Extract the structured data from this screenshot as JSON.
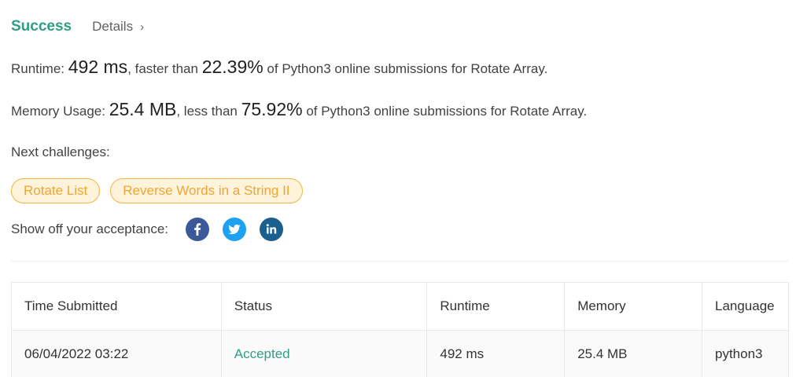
{
  "status": {
    "title": "Success",
    "details_label": "Details",
    "chevron": "›"
  },
  "runtime_line": {
    "label": "Runtime: ",
    "value": "492 ms",
    "middle": ", faster than ",
    "percent": "22.39%",
    "suffix": " of Python3 online submissions for Rotate Array."
  },
  "memory_line": {
    "label": "Memory Usage: ",
    "value": "25.4 MB",
    "middle": ", less than ",
    "percent": "75.92%",
    "suffix": " of Python3 online submissions for Rotate Array."
  },
  "next": {
    "label": "Next challenges:",
    "challenges": [
      "Rotate List",
      "Reverse Words in a String II"
    ]
  },
  "share": {
    "label": "Show off your acceptance:",
    "icons": [
      "facebook-icon",
      "twitter-icon",
      "linkedin-icon"
    ]
  },
  "table": {
    "headers": [
      "Time Submitted",
      "Status",
      "Runtime",
      "Memory",
      "Language"
    ],
    "rows": [
      [
        "06/04/2022 03:22",
        "Accepted",
        "492 ms",
        "25.4 MB",
        "python3"
      ]
    ]
  },
  "colors": {
    "success": "#2e9e89",
    "chip_border": "#f0b53c",
    "chip_bg": "#fff3dc",
    "chip_text": "#f0a531",
    "facebook": "#3b5998",
    "twitter": "#1da1f2",
    "linkedin": "#1a5f8e"
  }
}
